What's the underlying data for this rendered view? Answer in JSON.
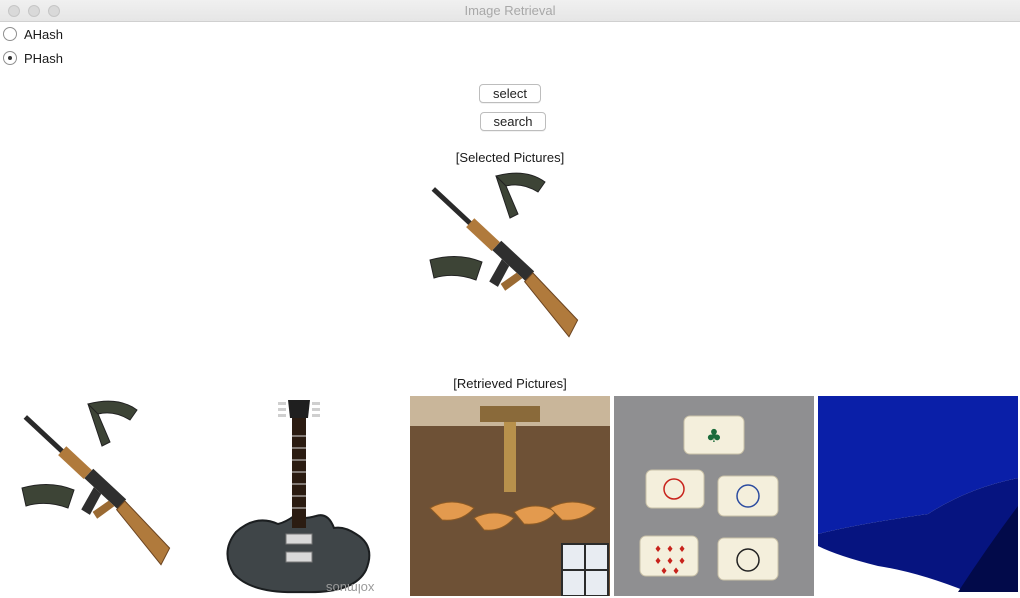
{
  "window": {
    "title": "Image Retrieval"
  },
  "options": [
    {
      "label": "AHash",
      "checked": false
    },
    {
      "label": "PHash",
      "checked": true
    }
  ],
  "buttons": {
    "select": "select",
    "search": "search"
  },
  "captions": {
    "selected": "[Selected Pictures]",
    "retrieved": "[Retrieved Pictures]"
  },
  "retrieved": [
    {
      "subject": "assault-rifle"
    },
    {
      "subject": "electric-guitar"
    },
    {
      "subject": "chandelier"
    },
    {
      "subject": "dice"
    },
    {
      "subject": "blue-mattress"
    }
  ],
  "guitar_text": "xolmuos"
}
